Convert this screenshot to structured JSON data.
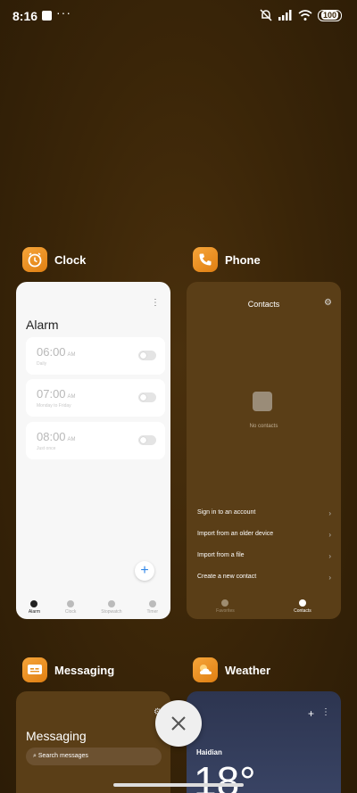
{
  "status_bar": {
    "time": "8:16",
    "dots": "···",
    "battery": "100"
  },
  "cards": {
    "clock": {
      "app_name": "Clock",
      "menu": "⋮",
      "alarm_title": "Alarm",
      "alarms": [
        {
          "time": "06:00",
          "ampm": "AM",
          "sub": "Daily"
        },
        {
          "time": "07:00",
          "ampm": "AM",
          "sub": "Monday to Friday"
        },
        {
          "time": "08:00",
          "ampm": "AM",
          "sub": "Just once"
        }
      ],
      "fab": "+",
      "nav": [
        "Alarm",
        "Clock",
        "Stopwatch",
        "Timer"
      ]
    },
    "phone": {
      "app_name": "Phone",
      "title": "Contacts",
      "empty_text": "No contacts",
      "options": [
        "Sign in to an account",
        "Import from an older device",
        "Import from a file",
        "Create a new contact"
      ],
      "nav": [
        "Favorites",
        "Contacts"
      ]
    },
    "messaging": {
      "app_name": "Messaging",
      "title": "Messaging",
      "search_placeholder": "Search messages"
    },
    "weather": {
      "app_name": "Weather",
      "city": "Haidian",
      "temperature": "18°",
      "plus": "+",
      "more": "⋮"
    }
  },
  "colors": {
    "background": "#3a2508",
    "app_icon": "#f09a2a",
    "accent_blue": "#2f86e8"
  }
}
